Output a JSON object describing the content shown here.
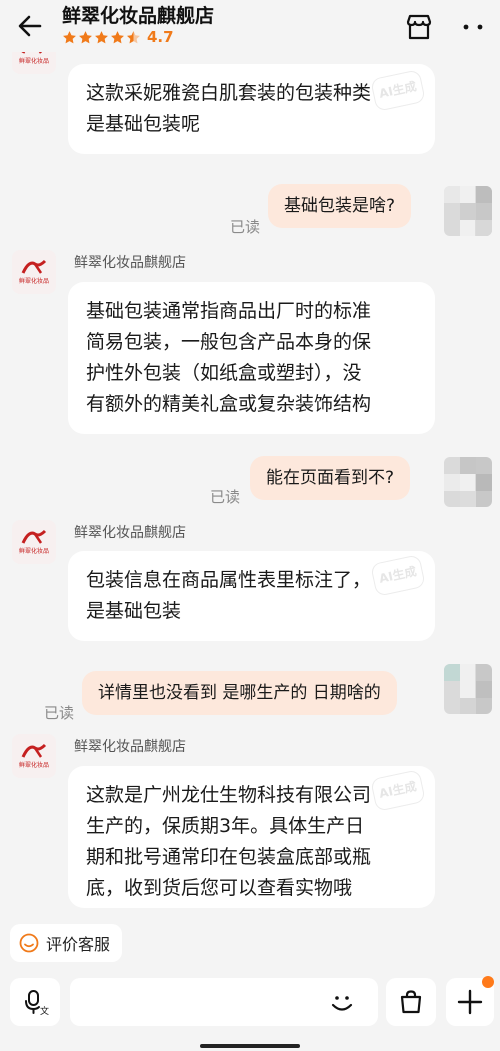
{
  "header": {
    "shop_name": "鲜翠化妆品麒舰店",
    "rating": "4.7",
    "stars_filled": 4.5
  },
  "shop_avatar": {
    "logo_text": "鲜翠化妆品"
  },
  "watermark_text": "AI生成",
  "messages": [
    {
      "from": "shop",
      "lines": [
        "这款采妮雅瓷白肌套装的包装种类",
        "是基础包装呢"
      ]
    },
    {
      "from": "user",
      "text": "基础包装是啥?",
      "status": "已读"
    },
    {
      "from": "shop",
      "name": "鲜翠化妆品麒舰店",
      "lines": [
        "基础包装通常指商品出厂时的标准",
        "简易包装，一般包含产品本身的保",
        "护性外包装（如纸盒或塑封），没",
        "有额外的精美礼盒或复杂装饰结构"
      ]
    },
    {
      "from": "user",
      "text": "能在页面看到不?",
      "status": "已读"
    },
    {
      "from": "shop",
      "name": "鲜翠化妆品麒舰店",
      "lines": [
        "包装信息在商品属性表里标注了，",
        "是基础包装"
      ]
    },
    {
      "from": "user",
      "text": "详情里也没看到 是哪生产的 日期啥的",
      "status": "已读"
    },
    {
      "from": "shop",
      "name": "鲜翠化妆品麒舰店",
      "lines": [
        "这款是广州龙仕生物科技有限公司",
        "生产的，保质期3年。具体生产日",
        "期和批号通常印在包装盒底部或瓶",
        "底，收到货后您可以查看实物哦"
      ]
    }
  ],
  "quick_actions": {
    "rate_service": "评价客服"
  },
  "icons": {
    "back": "back-arrow-icon",
    "store": "store-icon",
    "more": "more-icon",
    "voice": "microphone-icon",
    "emoji": "smile-icon",
    "bag": "shopping-bag-icon",
    "plus": "plus-icon"
  },
  "colors": {
    "accent": "#f07a1a",
    "outgoing_bubble": "#fde8dc",
    "incoming_bubble": "#ffffff",
    "background": "#f4f4f4",
    "brand_red": "#c52020"
  }
}
